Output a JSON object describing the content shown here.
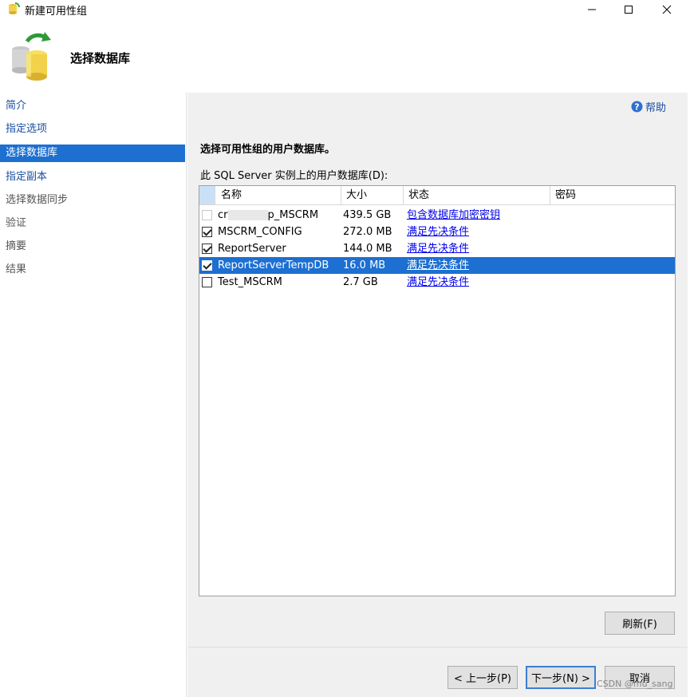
{
  "window": {
    "title": "新建可用性组"
  },
  "header": {
    "heading": "选择数据库"
  },
  "sidebar": {
    "items": [
      {
        "label": "简介",
        "state": "link"
      },
      {
        "label": "指定选项",
        "state": "link"
      },
      {
        "label": "选择数据库",
        "state": "active"
      },
      {
        "label": "指定副本",
        "state": "link"
      },
      {
        "label": "选择数据同步",
        "state": "disabled"
      },
      {
        "label": "验证",
        "state": "disabled"
      },
      {
        "label": "摘要",
        "state": "disabled"
      },
      {
        "label": "结果",
        "state": "disabled"
      }
    ]
  },
  "main": {
    "help_label": "帮助",
    "section_title": "选择可用性组的用户数据库。",
    "list_label": "此 SQL Server 实例上的用户数据库(D):",
    "columns": {
      "name": "名称",
      "size": "大小",
      "status": "状态",
      "password": "密码"
    },
    "rows": [
      {
        "name_prefix": "cr",
        "name_suffix": "p_MSCRM",
        "size": "439.5 GB",
        "status": "包含数据库加密密钥",
        "checked": false,
        "disabled": true,
        "selected": false
      },
      {
        "name": "MSCRM_CONFIG",
        "size": "272.0 MB",
        "status": "满足先决条件",
        "checked": true,
        "disabled": false,
        "selected": false
      },
      {
        "name": "ReportServer",
        "size": "144.0 MB",
        "status": "满足先决条件",
        "checked": true,
        "disabled": false,
        "selected": false
      },
      {
        "name": "ReportServerTempDB",
        "size": "16.0 MB",
        "status": "满足先决条件",
        "checked": true,
        "disabled": false,
        "selected": true
      },
      {
        "name": "Test_MSCRM",
        "size": "2.7 GB",
        "status": "满足先决条件",
        "checked": false,
        "disabled": false,
        "selected": false
      }
    ],
    "refresh_label": "刷新(F)"
  },
  "footer": {
    "back_label": "< 上一步(P)",
    "next_label": "下一步(N) >",
    "cancel_label": "取消"
  },
  "watermark": "CSDN @mu_sang",
  "colors": {
    "accent": "#1d6fd1",
    "link": "#1a4fa0",
    "panel_bg": "#f0f0f0"
  }
}
